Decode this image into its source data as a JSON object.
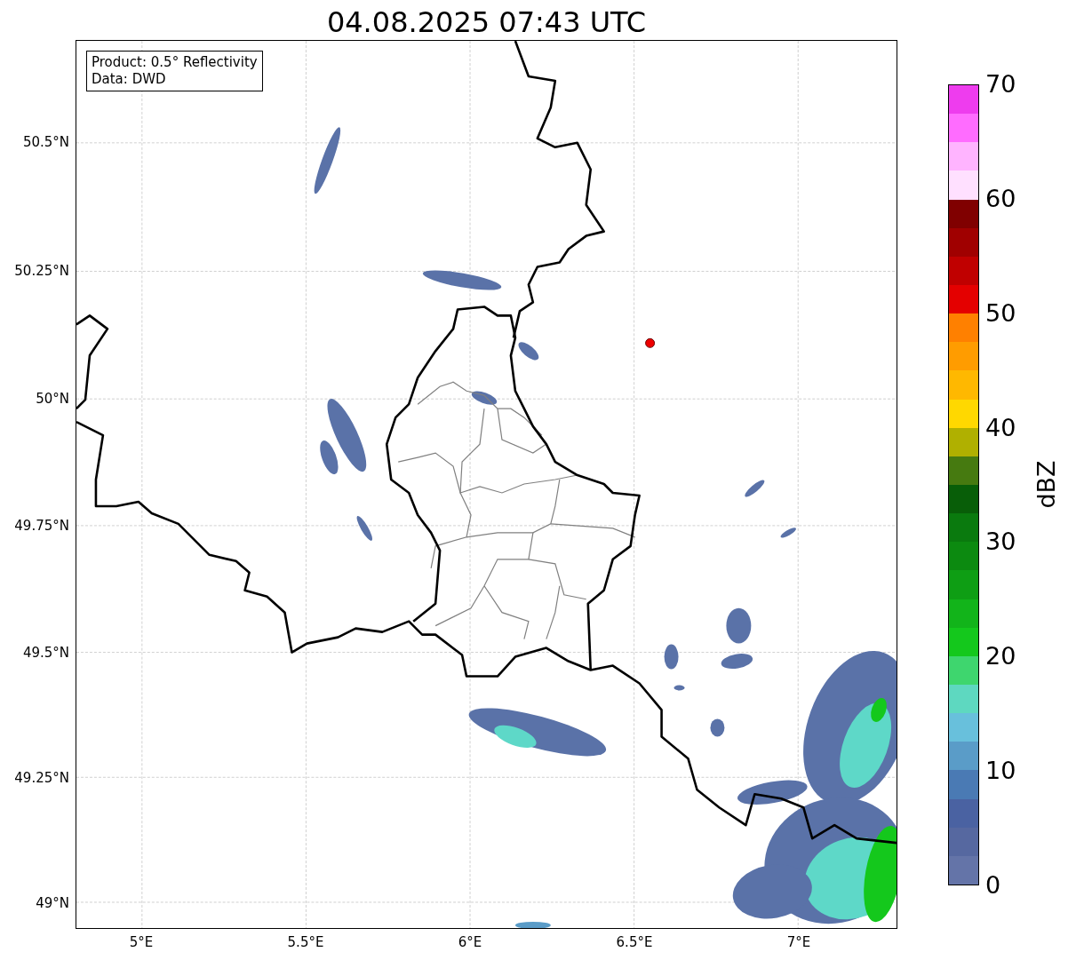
{
  "title": "04.08.2025 07:43 UTC",
  "legend": [
    "Product: 0.5° Reflectivity",
    "Data: DWD"
  ],
  "y_ticks": [
    "50.5°N",
    "50.25°N",
    "50°N",
    "49.75°N",
    "49.5°N",
    "49.25°N",
    "49°N"
  ],
  "x_ticks": [
    "5°E",
    "5.5°E",
    "6°E",
    "6.5°E",
    "7°E"
  ],
  "colorbar": {
    "label": "dBZ",
    "ticks": [
      "70",
      "60",
      "50",
      "40",
      "30",
      "20",
      "10",
      "0"
    ],
    "segments": [
      {
        "color": "#ee3cee"
      },
      {
        "color": "#ff6cff"
      },
      {
        "color": "#ffb4ff"
      },
      {
        "color": "#ffe0ff"
      },
      {
        "color": "#800000"
      },
      {
        "color": "#a00000"
      },
      {
        "color": "#c00000"
      },
      {
        "color": "#e40000"
      },
      {
        "color": "#ff8000"
      },
      {
        "color": "#ff9c00"
      },
      {
        "color": "#ffb800"
      },
      {
        "color": "#ffd800"
      },
      {
        "color": "#b0b000"
      },
      {
        "color": "#467a10"
      },
      {
        "color": "#085e08"
      },
      {
        "color": "#0a7a0e"
      },
      {
        "color": "#0c8a10"
      },
      {
        "color": "#0e9e14"
      },
      {
        "color": "#12b41a"
      },
      {
        "color": "#14c81c"
      },
      {
        "color": "#3ed66e"
      },
      {
        "color": "#5ed8c0"
      },
      {
        "color": "#68c0dc"
      },
      {
        "color": "#5a9cc8"
      },
      {
        "color": "#4a7ab4"
      },
      {
        "color": "#4a62a2"
      },
      {
        "color": "#5668a0"
      },
      {
        "color": "#6474a8"
      }
    ]
  }
}
